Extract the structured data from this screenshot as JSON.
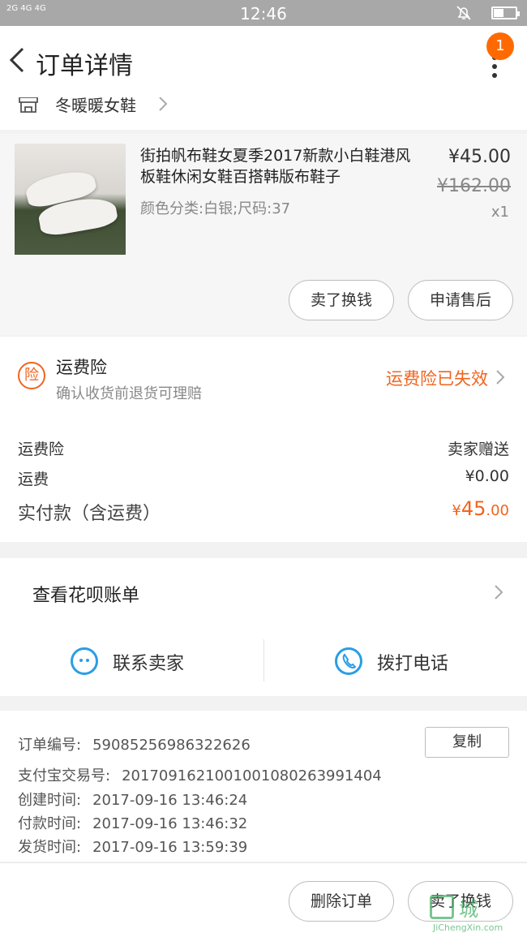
{
  "status_bar": {
    "signal": "2G  4G 4G",
    "time": "12:46",
    "battery_level": 0.45
  },
  "nav": {
    "title": "订单详情",
    "badge_count": "1"
  },
  "shop": {
    "name": "冬暖暖女鞋"
  },
  "product": {
    "title": "街拍帆布鞋女夏季2017新款小白鞋港风板鞋休闲女鞋百搭韩版布鞋子",
    "spec": "颜色分类:白银;尺码:37",
    "price": "¥45.00",
    "original_price": "¥162.00",
    "quantity": "x1",
    "buttons": {
      "sell": "卖了换钱",
      "after_sale": "申请售后"
    }
  },
  "insurance": {
    "icon_char": "险",
    "title": "运费险",
    "subtitle": "确认收货前退货可理赔",
    "status": "运费险已失效",
    "status_color": "#f0641e"
  },
  "summary": {
    "insurance_label": "运费险",
    "insurance_value": "卖家赠送",
    "shipping_label": "运费",
    "shipping_value": "¥0.00",
    "paid_label": "实付款（含运费）",
    "paid_currency": "¥",
    "paid_int": "45",
    "paid_dec": ".00"
  },
  "huabei": {
    "label": "查看花呗账单"
  },
  "contact": {
    "seller": "联系卖家",
    "phone": "拨打电话"
  },
  "order_info": {
    "copy_label": "复制",
    "rows": [
      {
        "label": "订单编号:",
        "value": "59085256986322626"
      },
      {
        "label": "支付宝交易号:",
        "value": "2017091621001001080263991404"
      },
      {
        "label": "创建时间:",
        "value": "2017-09-16 13:46:24"
      },
      {
        "label": "付款时间:",
        "value": "2017-09-16 13:46:32"
      },
      {
        "label": "发货时间:",
        "value": "2017-09-16 13:59:39"
      }
    ]
  },
  "bottom": {
    "delete_label": "删除订单",
    "sell_label": "卖了换钱"
  },
  "watermark": {
    "cn": "城",
    "en": "JiChengXin.com"
  }
}
